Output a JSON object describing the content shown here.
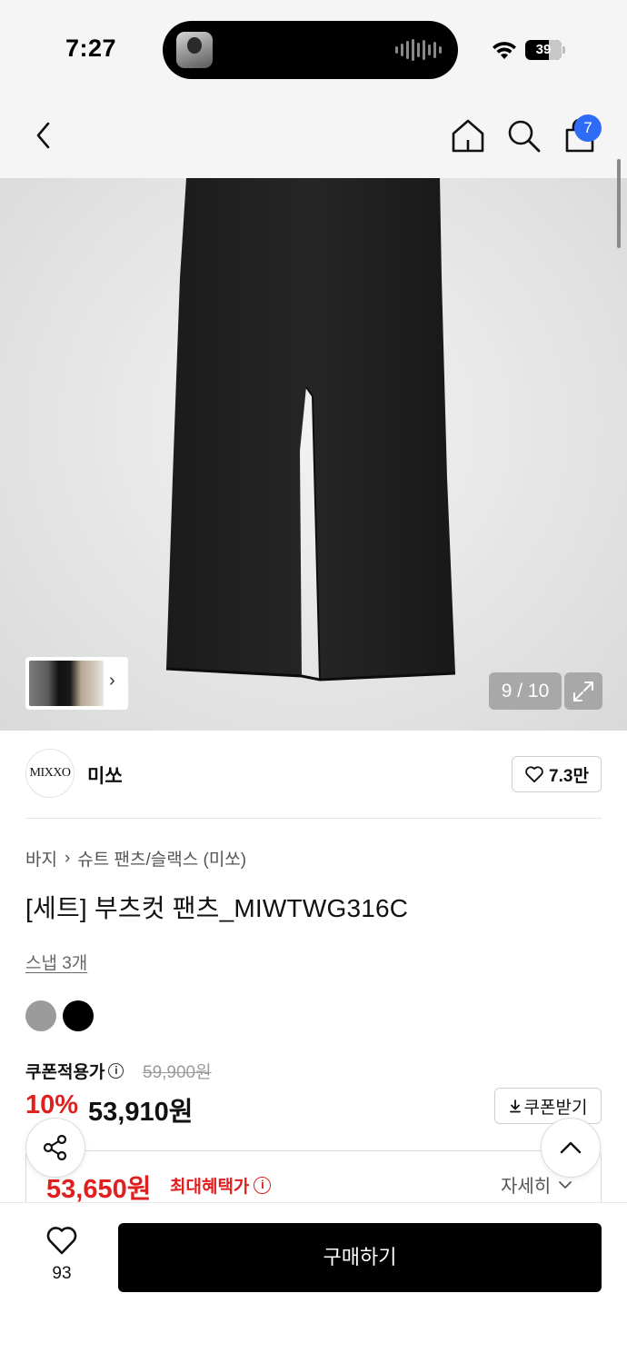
{
  "status_bar": {
    "time": "7:27",
    "battery": "39"
  },
  "nav": {
    "cart_count": "7"
  },
  "gallery": {
    "counter": "9 / 10"
  },
  "brand": {
    "logo_text": "MIXXO",
    "name": "미쏘",
    "likes": "7.3만"
  },
  "product": {
    "breadcrumb": [
      "바지",
      "슈트 팬츠/슬랙스 (미쏘)"
    ],
    "title": "[세트] 부츠컷 팬츠_MIWTWG316C",
    "snap": "스냅 3개",
    "colors": [
      "#9b9b9b",
      "#000000"
    ]
  },
  "price": {
    "coupon_label": "쿠폰적용가",
    "original": "59,900원",
    "discount": "10%",
    "sale": "53,910원",
    "coupon_button": "쿠폰받기",
    "max_benefit_price": "53,650원",
    "max_benefit_label": "최대혜택가",
    "detail": "자세히"
  },
  "bottom": {
    "wish_count": "93",
    "buy_label": "구매하기"
  },
  "colors": {
    "accent_red": "#e0201f",
    "badge_blue": "#2f6cf5"
  }
}
